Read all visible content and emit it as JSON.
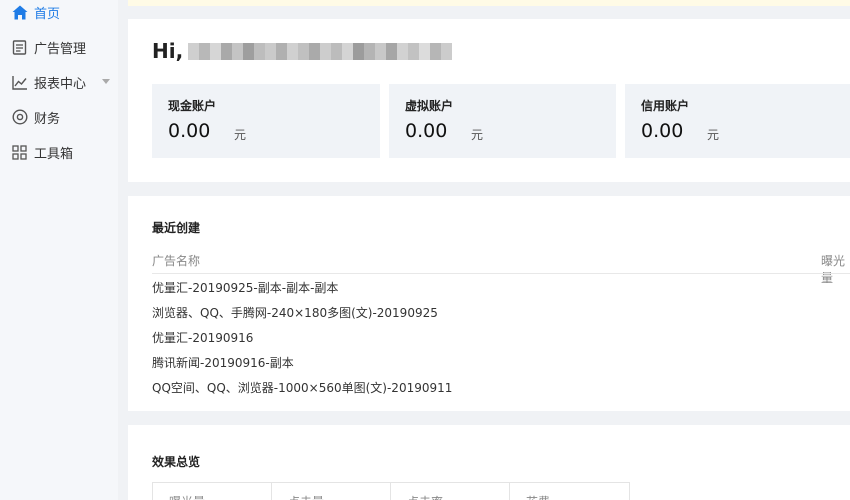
{
  "sidebar": {
    "items": [
      {
        "label": "首页",
        "icon": "home-icon",
        "active": true
      },
      {
        "label": "广告管理",
        "icon": "document-icon"
      },
      {
        "label": "报表中心",
        "icon": "line-chart-icon",
        "has_submenu": true
      },
      {
        "label": "财务",
        "icon": "finance-circle-icon"
      },
      {
        "label": "工具箱",
        "icon": "grid-icon"
      }
    ]
  },
  "welcome": {
    "greeting": "Hi, "
  },
  "accounts": [
    {
      "label": "现金账户",
      "amount": "0.00",
      "unit": "元"
    },
    {
      "label": "虚拟账户",
      "amount": "0.00",
      "unit": "元"
    },
    {
      "label": "信用账户",
      "amount": "0.00",
      "unit": "元"
    }
  ],
  "recent": {
    "title": "最近创建",
    "columns": [
      "广告名称",
      "曝光量"
    ],
    "rows": [
      "优量汇-20190925-副本-副本-副本",
      "浏览器、QQ、手腾网-240×180多图(文)-20190925",
      "优量汇-20190916",
      "腾讯新闻-20190916-副本",
      "QQ空间、QQ、浏览器-1000×560单图(文)-20190911"
    ]
  },
  "overview": {
    "title": "效果总览",
    "metrics": [
      "曝光量",
      "点击量",
      "点击率",
      "花费"
    ]
  },
  "colors": {
    "accent": "#1f7ce6",
    "background": "#f0f2f5",
    "account_card": "#f0f3f7"
  }
}
